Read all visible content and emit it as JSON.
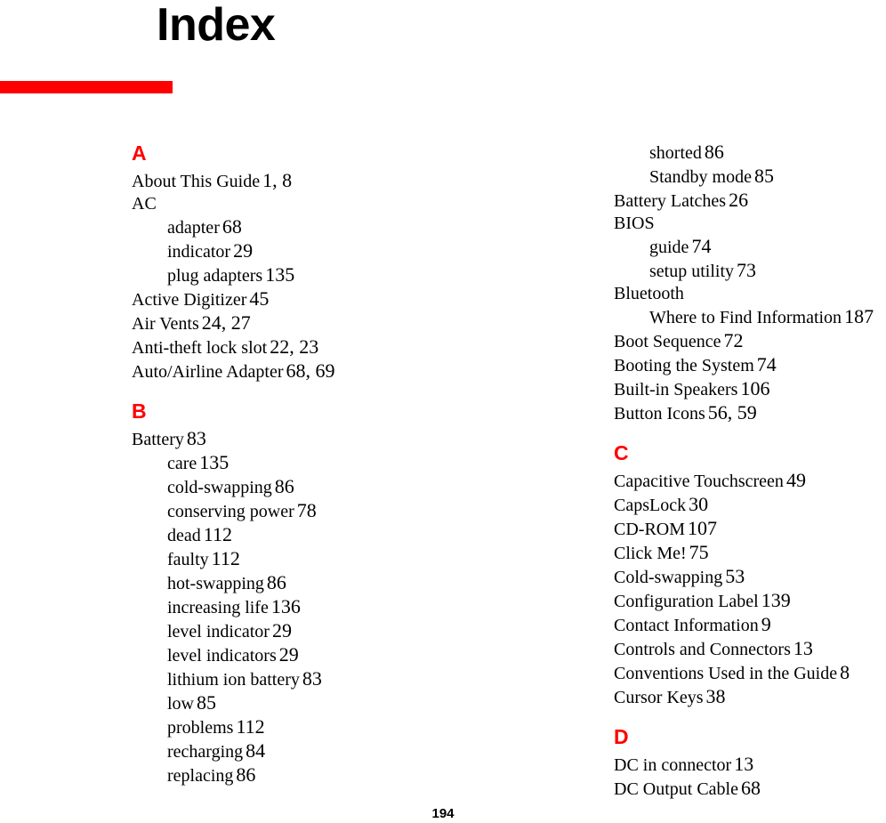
{
  "page": {
    "title": "Index",
    "page_number": "194",
    "accent_color": "#FF0000",
    "text_color": "#000000",
    "background_color": "#FFFFFF"
  },
  "columns": [
    {
      "id": "left",
      "sections": [
        {
          "letter": "A",
          "entries": [
            {
              "level": 0,
              "term": "About This Guide",
              "pages": "1, 8"
            },
            {
              "level": 0,
              "term": "AC",
              "pages": ""
            },
            {
              "level": 1,
              "term": "adapter",
              "pages": "68"
            },
            {
              "level": 1,
              "term": "indicator",
              "pages": "29"
            },
            {
              "level": 1,
              "term": "plug adapters",
              "pages": "135"
            },
            {
              "level": 0,
              "term": "Active Digitizer",
              "pages": "45"
            },
            {
              "level": 0,
              "term": "Air Vents",
              "pages": "24, 27"
            },
            {
              "level": 0,
              "term": "Anti-theft lock slot",
              "pages": "22, 23"
            },
            {
              "level": 0,
              "term": "Auto/Airline Adapter",
              "pages": "68, 69"
            }
          ]
        },
        {
          "letter": "B",
          "entries": [
            {
              "level": 0,
              "term": "Battery",
              "pages": "83"
            },
            {
              "level": 1,
              "term": "care",
              "pages": "135"
            },
            {
              "level": 1,
              "term": "cold-swapping",
              "pages": "86"
            },
            {
              "level": 1,
              "term": "conserving power",
              "pages": "78"
            },
            {
              "level": 1,
              "term": "dead",
              "pages": "112"
            },
            {
              "level": 1,
              "term": "faulty",
              "pages": "112"
            },
            {
              "level": 1,
              "term": "hot-swapping",
              "pages": "86"
            },
            {
              "level": 1,
              "term": "increasing life",
              "pages": "136"
            },
            {
              "level": 1,
              "term": "level indicator",
              "pages": "29"
            },
            {
              "level": 1,
              "term": "level indicators",
              "pages": "29"
            },
            {
              "level": 1,
              "term": "lithium ion battery",
              "pages": "83"
            },
            {
              "level": 1,
              "term": "low",
              "pages": "85"
            },
            {
              "level": 1,
              "term": "problems",
              "pages": "112"
            },
            {
              "level": 1,
              "term": "recharging",
              "pages": "84"
            },
            {
              "level": 1,
              "term": "replacing",
              "pages": "86"
            }
          ]
        }
      ]
    },
    {
      "id": "right",
      "sections": [
        {
          "letter": "",
          "entries": [
            {
              "level": 1,
              "term": "shorted",
              "pages": "86"
            },
            {
              "level": 1,
              "term": "Standby mode",
              "pages": "85"
            },
            {
              "level": 0,
              "term": "Battery Latches",
              "pages": "26"
            },
            {
              "level": 0,
              "term": "BIOS",
              "pages": ""
            },
            {
              "level": 1,
              "term": "guide",
              "pages": "74"
            },
            {
              "level": 1,
              "term": "setup utility",
              "pages": "73"
            },
            {
              "level": 0,
              "term": "Bluetooth",
              "pages": ""
            },
            {
              "level": 1,
              "term": "Where to Find Information",
              "pages": "187"
            },
            {
              "level": 0,
              "term": "Boot Sequence",
              "pages": "72"
            },
            {
              "level": 0,
              "term": "Booting the System",
              "pages": "74"
            },
            {
              "level": 0,
              "term": "Built-in Speakers",
              "pages": "106"
            },
            {
              "level": 0,
              "term": "Button Icons",
              "pages": "56, 59"
            }
          ]
        },
        {
          "letter": "C",
          "entries": [
            {
              "level": 0,
              "term": "Capacitive Touchscreen",
              "pages": "49"
            },
            {
              "level": 0,
              "term": "CapsLock",
              "pages": "30"
            },
            {
              "level": 0,
              "term": "CD-ROM",
              "pages": "107"
            },
            {
              "level": 0,
              "term": "Click Me!",
              "pages": "75"
            },
            {
              "level": 0,
              "term": "Cold-swapping",
              "pages": "53"
            },
            {
              "level": 0,
              "term": "Configuration Label",
              "pages": "139"
            },
            {
              "level": 0,
              "term": "Contact Information",
              "pages": "9"
            },
            {
              "level": 0,
              "term": "Controls and Connectors",
              "pages": "13"
            },
            {
              "level": 0,
              "term": "Conventions Used in the Guide",
              "pages": "8"
            },
            {
              "level": 0,
              "term": "Cursor Keys",
              "pages": "38"
            }
          ]
        },
        {
          "letter": "D",
          "entries": [
            {
              "level": 0,
              "term": "DC in connector",
              "pages": "13"
            },
            {
              "level": 0,
              "term": "DC Output Cable",
              "pages": "68"
            }
          ]
        }
      ]
    }
  ]
}
